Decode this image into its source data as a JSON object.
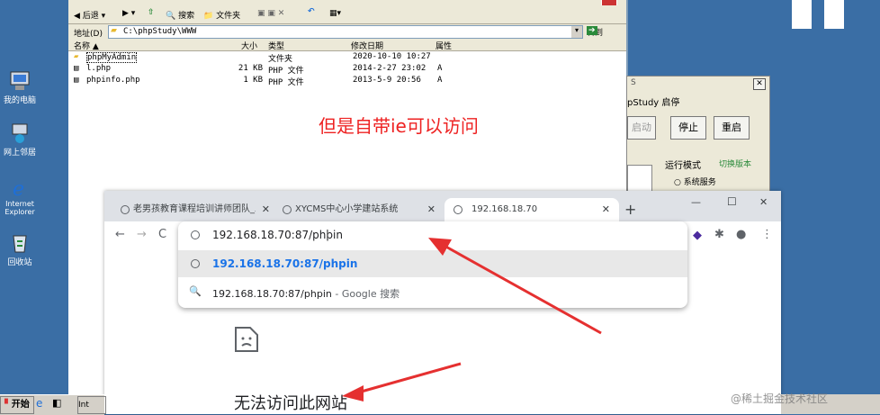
{
  "desktop": {
    "icons": [
      "我的电脑",
      "网上邻居",
      "Internet Explorer",
      "回收站"
    ]
  },
  "explorer": {
    "toolbar": {
      "back": "后退",
      "search": "搜索",
      "folders": "文件夹"
    },
    "address_label": "地址(D)",
    "address_value": "C:\\phpStudy\\WWW",
    "go": "转到",
    "columns": {
      "name": "名称",
      "size": "大小",
      "type": "类型",
      "date": "修改日期",
      "attr": "属性"
    },
    "rows": [
      {
        "name": "phpMyAdmin",
        "size": "",
        "type": "文件夹",
        "date": "2020-10-10 10:27",
        "attr": ""
      },
      {
        "name": "l.php",
        "size": "21 KB",
        "type": "PHP 文件",
        "date": "2014-2-27 23:02",
        "attr": "A"
      },
      {
        "name": "phpinfo.php",
        "size": "1 KB",
        "type": "PHP 文件",
        "date": "2013-5-9 20:56",
        "attr": "A"
      }
    ],
    "annotation": "但是自带ie可以访问"
  },
  "phpstudy": {
    "title_partial": "pStudy 启停",
    "btn_start": "启动",
    "btn_stop": "停止",
    "btn_restart": "重启",
    "mode_label": "运行模式",
    "switch_version": "切换版本",
    "option_service": "系统服务",
    "title_letter": "S"
  },
  "chrome": {
    "tabs": [
      {
        "title": "老男孩教育课程培训讲师团队_工"
      },
      {
        "title": "XYCMS中心小学建站系统"
      },
      {
        "title": "192.168.18.70"
      }
    ],
    "new_tab": "+",
    "window": {
      "min": "—",
      "max": "☐",
      "close": "✕"
    },
    "omnibox_value": "192.168.18.70:87/phpin",
    "suggestions": [
      {
        "text": "192.168.18.70:87/phpin",
        "suffix": ""
      },
      {
        "text": "192.168.18.70:87/phpin",
        "suffix": " - Google 搜索"
      }
    ],
    "error_title": "无法访问此网站"
  },
  "taskbar": {
    "start": "开始",
    "item": "Int"
  },
  "watermark": "@稀土掘金技术社区",
  "colors": {
    "accent_red": "#ee2222",
    "link_blue": "#1a73e8",
    "desktop": "#3a6ea5"
  }
}
